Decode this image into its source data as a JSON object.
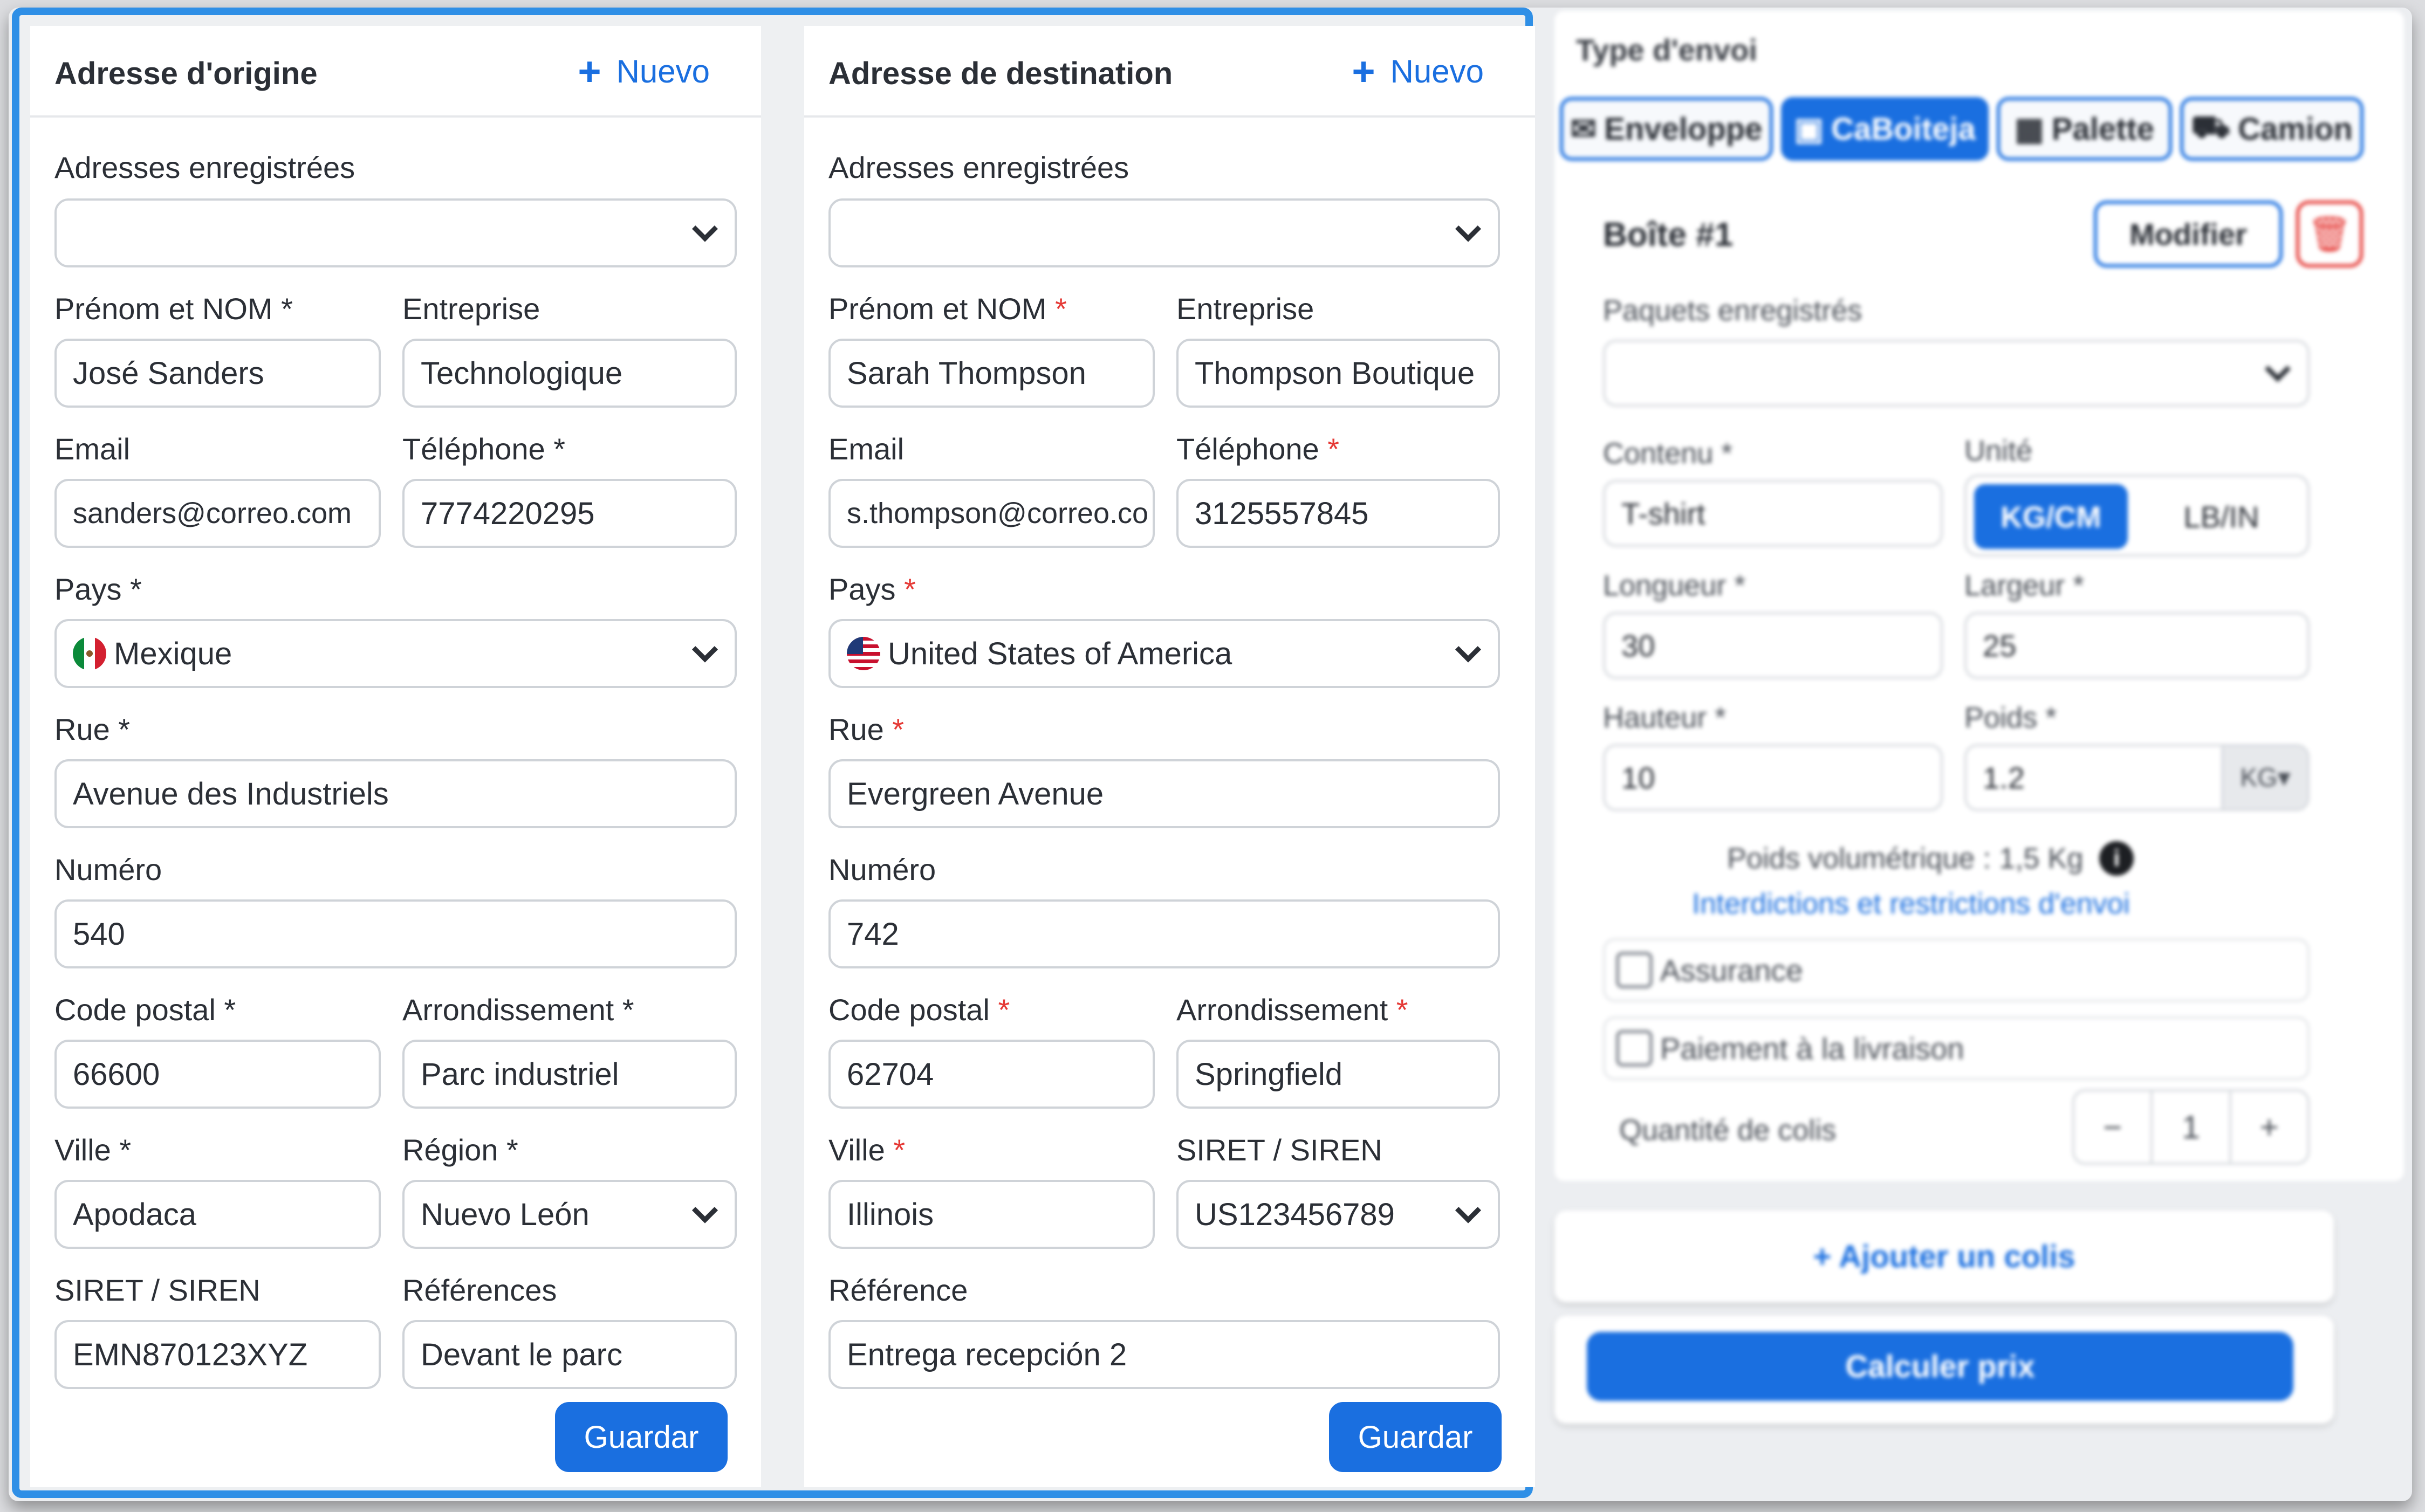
{
  "origin": {
    "title": "Adresse d'origine",
    "new_label": "Nuevo",
    "saved_label": "Adresses enregistrées",
    "saved_value": "",
    "name_label": "Prénom et NOM *",
    "name_value": "José Sanders",
    "company_label": "Entreprise",
    "company_value": "Technologique",
    "email_label": "Email",
    "email_value": "sanders@correo.com",
    "phone_label": "Téléphone *",
    "phone_value": "7774220295",
    "country_label": "Pays *",
    "country_value": "Mexique",
    "street_label": "Rue *",
    "street_value": "Avenue des Industriels",
    "number_label": "Numéro",
    "number_value": "540",
    "postal_label": "Code postal *",
    "postal_value": "66600",
    "district_label": "Arrondissement *",
    "district_value": "Parc industriel",
    "city_label": "Ville *",
    "city_value": "Apodaca",
    "region_label": "Région *",
    "region_value": "Nuevo León",
    "siret_label": "SIRET / SIREN",
    "siret_value": "EMN870123XYZ",
    "ref_label": "Références",
    "ref_value": "Devant le parc",
    "save_label": "Guardar"
  },
  "destination": {
    "title": "Adresse de destination",
    "new_label": "Nuevo",
    "saved_label": "Adresses enregistrées",
    "saved_value": "",
    "name_label": "Prénom et NOM",
    "name_value": "Sarah Thompson",
    "company_label": "Entreprise",
    "company_value": "Thompson Boutique",
    "email_label": "Email",
    "email_value": "s.thompson@correo.co",
    "phone_label": "Téléphone",
    "phone_value": "3125557845",
    "country_label": "Pays",
    "country_value": "United States of America",
    "street_label": "Rue",
    "street_value": "Evergreen Avenue",
    "number_label": "Numéro",
    "number_value": "742",
    "postal_label": "Code postal",
    "postal_value": "62704",
    "district_label": "Arrondissement",
    "district_value": "Springfield",
    "city_label": "Ville",
    "city_value": "Illinois",
    "siret_label": "SIRET / SIREN",
    "siret_value": "US123456789",
    "ref_label": "Référence",
    "ref_value": "Entrega recepción 2",
    "save_label": "Guardar",
    "required_mark": "*"
  },
  "shipment": {
    "title": "Type d'envoi",
    "tabs": [
      "Enveloppe",
      "CaBoiteja",
      "Palette",
      "Camion"
    ],
    "active_tab": "CaBoiteja",
    "box_title": "Boîte #1",
    "modify_label": "Modifier",
    "saved_packages_label": "Paquets enregistrés",
    "content_label": "Contenu *",
    "content_value": "T-shirt",
    "unit_label": "Unité",
    "unit_on": "KG/CM",
    "unit_off": "LB/IN",
    "length_label": "Longueur *",
    "length_value": "30",
    "width_label": "Largeur *",
    "width_value": "25",
    "height_label": "Hauteur *",
    "height_value": "10",
    "weight_label": "Poids *",
    "weight_value": "1.2",
    "weight_unit": "KG",
    "volumetric": "Poids volumétrique : 1,5 Kg",
    "restrictions_link": "Interdictions et restrictions d'envoi",
    "insurance_label": "Assurance",
    "cod_label": "Paiement à la livraison",
    "quantity_label": "Quantité de colis",
    "quantity_value": "1",
    "add_package": "+ Ajouter un colis",
    "calculate": "Calculer prix"
  },
  "colors": {
    "accent": "#1a6fe0",
    "frame": "#2f8fe6",
    "required": "#e53935",
    "delete": "#e53935"
  }
}
